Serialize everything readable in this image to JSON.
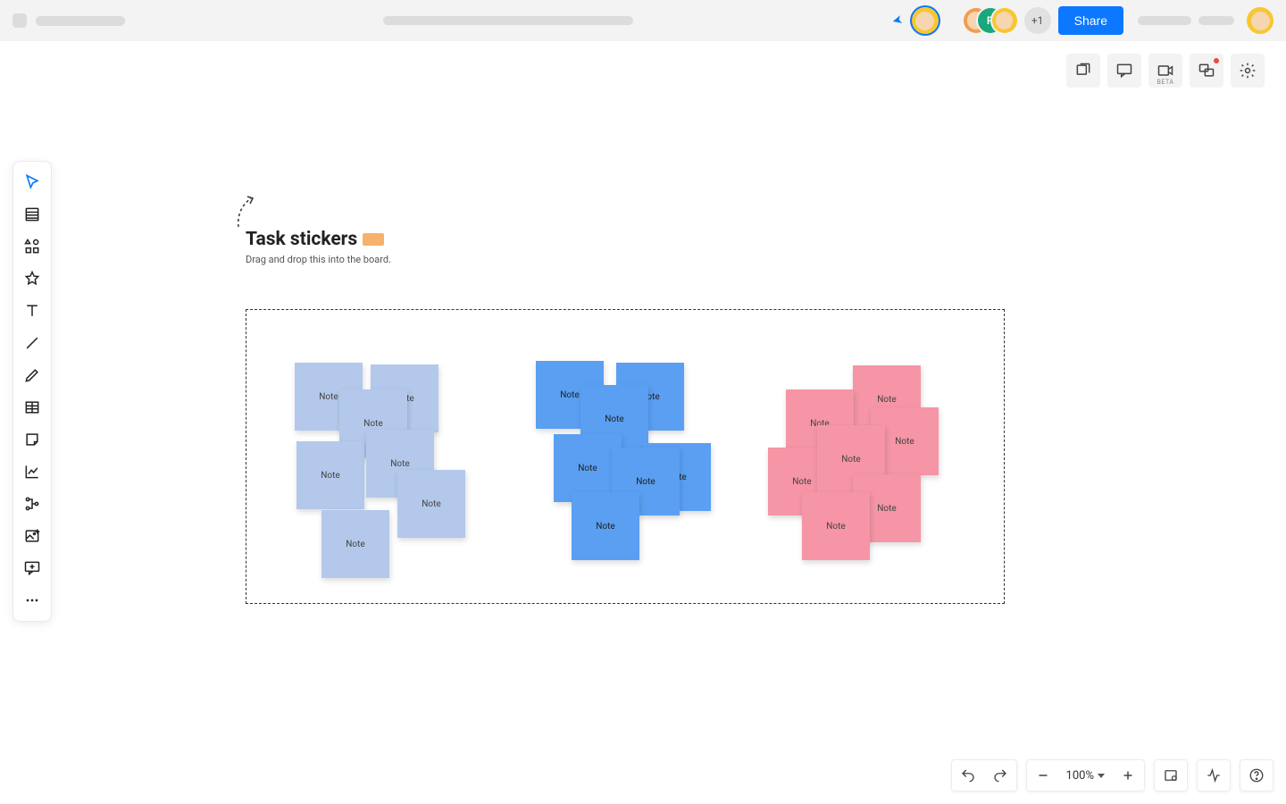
{
  "topbar": {
    "share_label": "Share",
    "more_users_label": "+1"
  },
  "tool_row": {
    "beta_label": "BETA"
  },
  "bottom": {
    "zoom_label": "100%"
  },
  "canvas": {
    "title": "Task stickers",
    "subtitle": "Drag and drop this into the board.",
    "note_label": "Note"
  },
  "piles": {
    "a": [
      "Note",
      "Note",
      "Note",
      "Note",
      "Note",
      "Note",
      "Note"
    ],
    "b": [
      "Note",
      "Note",
      "Note",
      "Note",
      "Note",
      "Note"
    ],
    "c": [
      "Note",
      "Note",
      "Note",
      "Note",
      "Note",
      "Note",
      "Note"
    ]
  }
}
